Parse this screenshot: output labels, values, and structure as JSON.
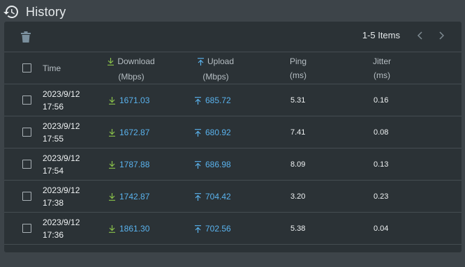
{
  "header": {
    "title": "History",
    "icon": "history-icon"
  },
  "toolbar": {
    "items_label": "1-5 Items",
    "delete_icon": "trash-icon",
    "prev_icon": "chevron-left-icon",
    "next_icon": "chevron-right-icon"
  },
  "columns": {
    "time": "Time",
    "download": "Download",
    "download_unit": "(Mbps)",
    "upload": "Upload",
    "upload_unit": "(Mbps)",
    "ping": "Ping",
    "ping_unit": "(ms)",
    "jitter": "Jitter",
    "jitter_unit": "(ms)"
  },
  "rows": [
    {
      "date": "2023/9/12",
      "time": "17:56",
      "download": "1671.03",
      "upload": "685.72",
      "ping": "5.31",
      "jitter": "0.16"
    },
    {
      "date": "2023/9/12",
      "time": "17:55",
      "download": "1672.87",
      "upload": "680.92",
      "ping": "7.41",
      "jitter": "0.08"
    },
    {
      "date": "2023/9/12",
      "time": "17:54",
      "download": "1787.88",
      "upload": "686.98",
      "ping": "8.09",
      "jitter": "0.13"
    },
    {
      "date": "2023/9/12",
      "time": "17:38",
      "download": "1742.87",
      "upload": "704.42",
      "ping": "3.20",
      "jitter": "0.23"
    },
    {
      "date": "2023/9/12",
      "time": "17:36",
      "download": "1861.30",
      "upload": "702.56",
      "ping": "5.38",
      "jitter": "0.04"
    }
  ],
  "colors": {
    "download_icon": "#8bc34a",
    "upload_icon": "#5ab3ee",
    "value_text": "#5ab3ee",
    "panel_bg": "#2b3236",
    "page_bg": "#3d4449"
  }
}
